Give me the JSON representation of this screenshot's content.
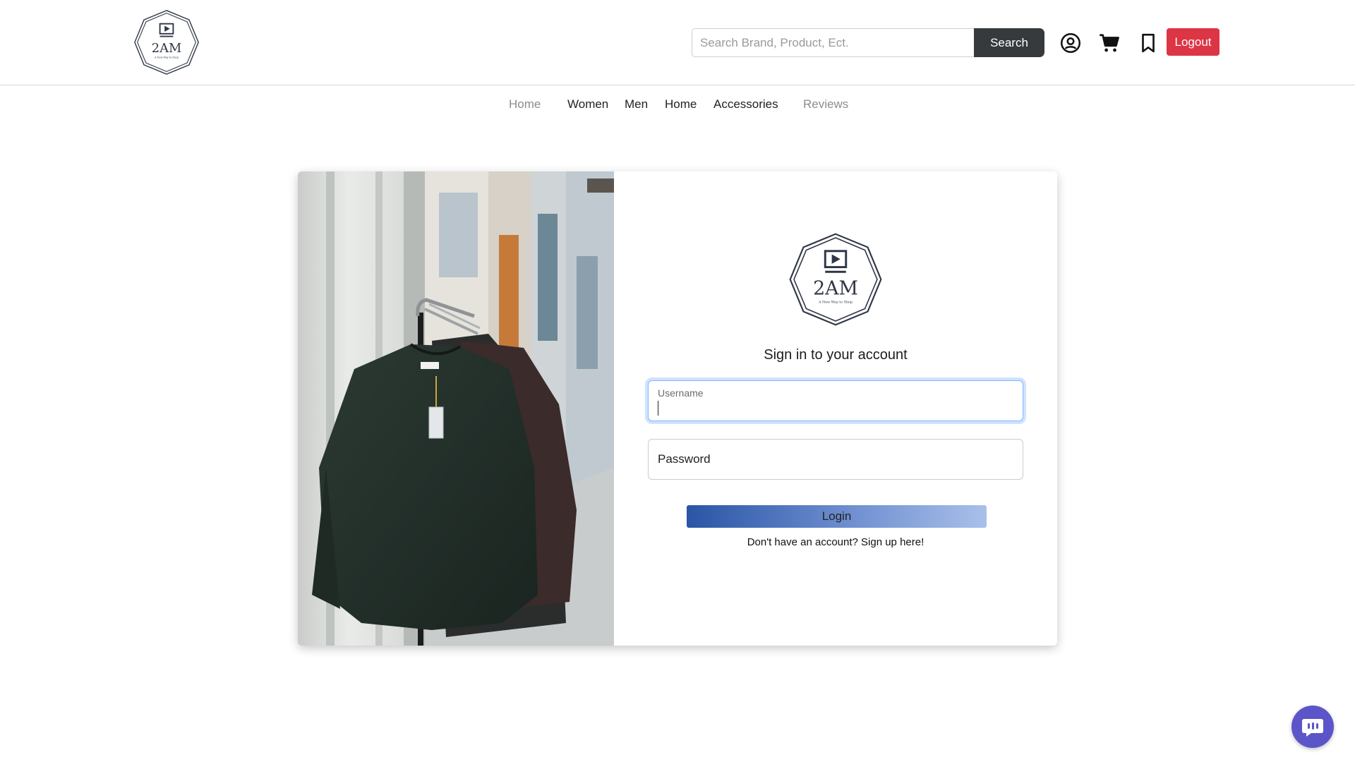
{
  "header": {
    "logo_text": "2AM",
    "logo_tagline": "A New Way to Shop",
    "search": {
      "placeholder": "Search Brand, Product, Ect.",
      "value": "",
      "button_label": "Search"
    },
    "icons": [
      "account-icon",
      "cart-icon",
      "bookmark-icon"
    ],
    "logout_label": "Logout"
  },
  "nav": {
    "items": [
      {
        "label": "Home",
        "muted": true
      },
      {
        "label": "Women",
        "muted": false
      },
      {
        "label": "Men",
        "muted": false
      },
      {
        "label": "Home",
        "muted": false
      },
      {
        "label": "Accessories",
        "muted": false
      },
      {
        "label": "Reviews",
        "muted": true
      }
    ]
  },
  "login": {
    "logo_text": "2AM",
    "logo_tagline": "A New Way to Shop",
    "title": "Sign in to your account",
    "username_label": "Username",
    "username_value": "",
    "password_label": "Password",
    "button_label": "Login",
    "signup_text": "Don't have an account? Sign up here!"
  },
  "colors": {
    "logout": "#dc3545",
    "search_button": "#373a3c",
    "login_gradient_start": "#2a55a5",
    "login_gradient_end": "#a9c0ea",
    "chat_button": "#5c55c9"
  },
  "chat": {
    "icon": "chat-icon"
  }
}
